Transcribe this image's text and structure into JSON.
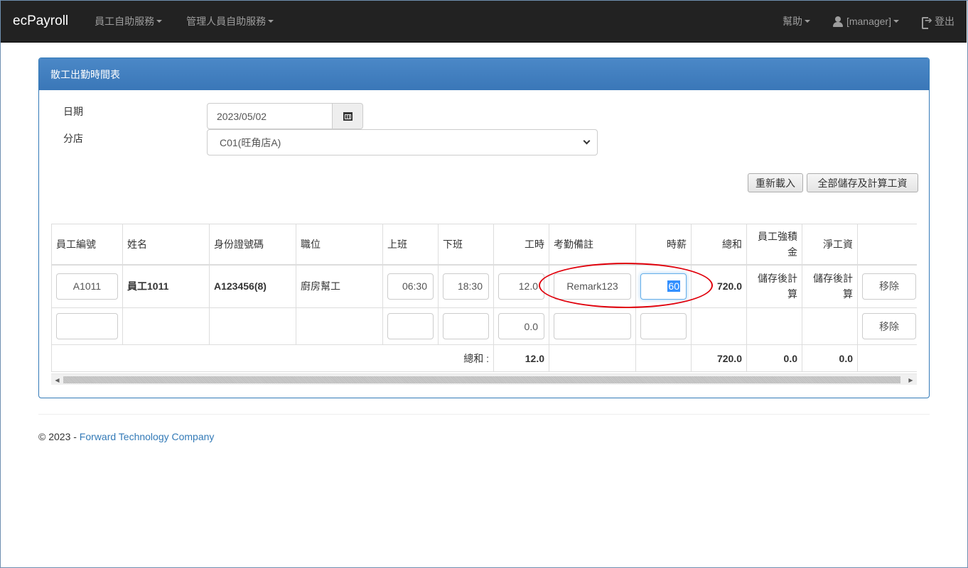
{
  "navbar": {
    "brand": "ecPayroll",
    "menu_employee": "員工自助服務",
    "menu_manager": "管理人員自助服務",
    "help": "幫助",
    "user": "[manager]",
    "logout": "登出"
  },
  "panel": {
    "title": "散工出勤時間表",
    "date_label": "日期",
    "date_value": "2023/05/02",
    "branch_label": "分店",
    "branch_value": "C01(旺角店A)",
    "reload_button": "重新載入",
    "save_all_button": "全部儲存及計算工資"
  },
  "table": {
    "headers": {
      "emp_no": "員工編號",
      "name": "姓名",
      "id_no": "身份證號碼",
      "position": "職位",
      "start": "上班",
      "end": "下班",
      "hours": "工時",
      "remark": "考勤備註",
      "rate": "時薪",
      "total": "總和",
      "mpf_line1": "員工強積",
      "mpf_line2": "金",
      "net": "淨工資"
    },
    "rows": [
      {
        "emp_no": "A1011",
        "name_prefix": "員工",
        "name_num": "1011",
        "id_no": "A123456(8)",
        "position": "廚房幫工",
        "start": "06:30",
        "end": "18:30",
        "hours": "12.0",
        "remark": "Remark123",
        "rate": "60",
        "total": "720.0",
        "mpf_line1": "儲存後計",
        "mpf_line2": "算",
        "net_line1": "儲存後計",
        "net_line2": "算",
        "remove": "移除"
      },
      {
        "emp_no": "",
        "hours": "0.0",
        "remove": "移除"
      }
    ],
    "summary": {
      "label": "總和 :",
      "hours": "12.0",
      "total": "720.0",
      "mpf": "0.0",
      "net": "0.0"
    }
  },
  "footer": {
    "copyright": "© 2023 - ",
    "company": "Forward Technology Company"
  },
  "colors": {
    "navbar_bg": "#222222",
    "panel_primary": "#337ab7",
    "annotation": "#e0000b",
    "link": "#337ab7"
  }
}
